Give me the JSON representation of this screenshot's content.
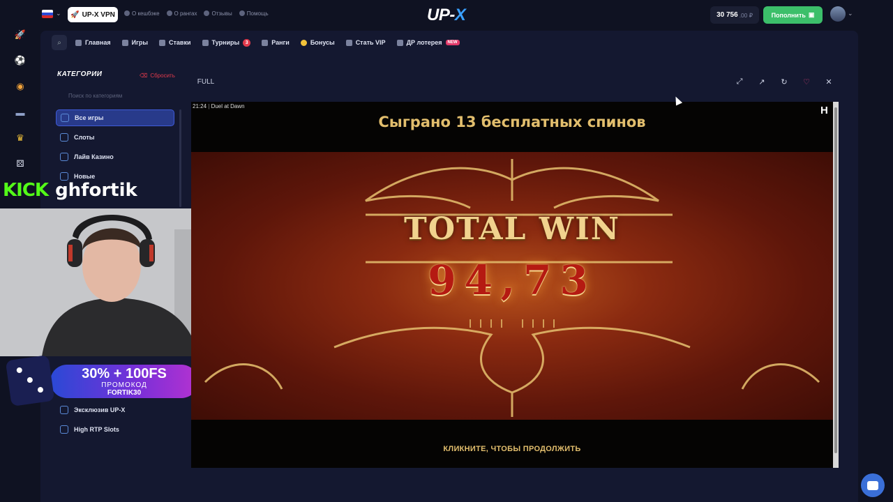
{
  "header": {
    "vpn_label": "UP-X VPN",
    "links": [
      "О кешбэке",
      "О рангах",
      "Отзывы",
      "Помощь"
    ],
    "logo_left": "UP-",
    "logo_right": "X",
    "balance_value": "30 756",
    "balance_fraction": ".00 ₽",
    "deposit_label": "Пополнить"
  },
  "rail": {
    "icons": [
      "rocket-icon",
      "football-icon",
      "coin-icon",
      "case-icon",
      "crown-icon",
      "dice-icon"
    ]
  },
  "nav": {
    "items": [
      {
        "label": "Главная"
      },
      {
        "label": "Игры"
      },
      {
        "label": "Ставки"
      },
      {
        "label": "Турниры",
        "badge": "3"
      },
      {
        "label": "Ранги"
      },
      {
        "label": "Бонусы"
      },
      {
        "label": "Стать VIP"
      },
      {
        "label": "ДР лотерея",
        "tag": "NEW"
      }
    ]
  },
  "categories": {
    "title": "КАТЕГОРИИ",
    "reset_label": "Сбросить",
    "search_placeholder": "Поиск по категориям",
    "items": [
      "Все игры",
      "Слоты",
      "Лайв Казино",
      "Новые"
    ],
    "items_bottom": [
      "Эксклюзив UP-X",
      "High RTP Slots"
    ]
  },
  "stream": {
    "platform": "KICK",
    "channel": "ghfortik",
    "promo_line1": "30% + 100FS",
    "promo_line2": "ПРОМОКОД",
    "promo_line3": "FORTIK30"
  },
  "game": {
    "full_label": "FULL",
    "time": "21:24",
    "title": "Duel at Dawn",
    "spins_text": "Сыграно 13 бесплатных спинов",
    "total_win_label": "TOTAL WIN",
    "total_win_value": "94,73",
    "continue_text": "КЛИКНИТЕ, ЧТОБЫ ПРОДОЛЖИТЬ",
    "provider_mark": "H"
  },
  "colors": {
    "accent": "#3aa0ff",
    "deposit": "#3cbf6a",
    "kick": "#53fc18",
    "gold_text": "#e2be6d"
  }
}
